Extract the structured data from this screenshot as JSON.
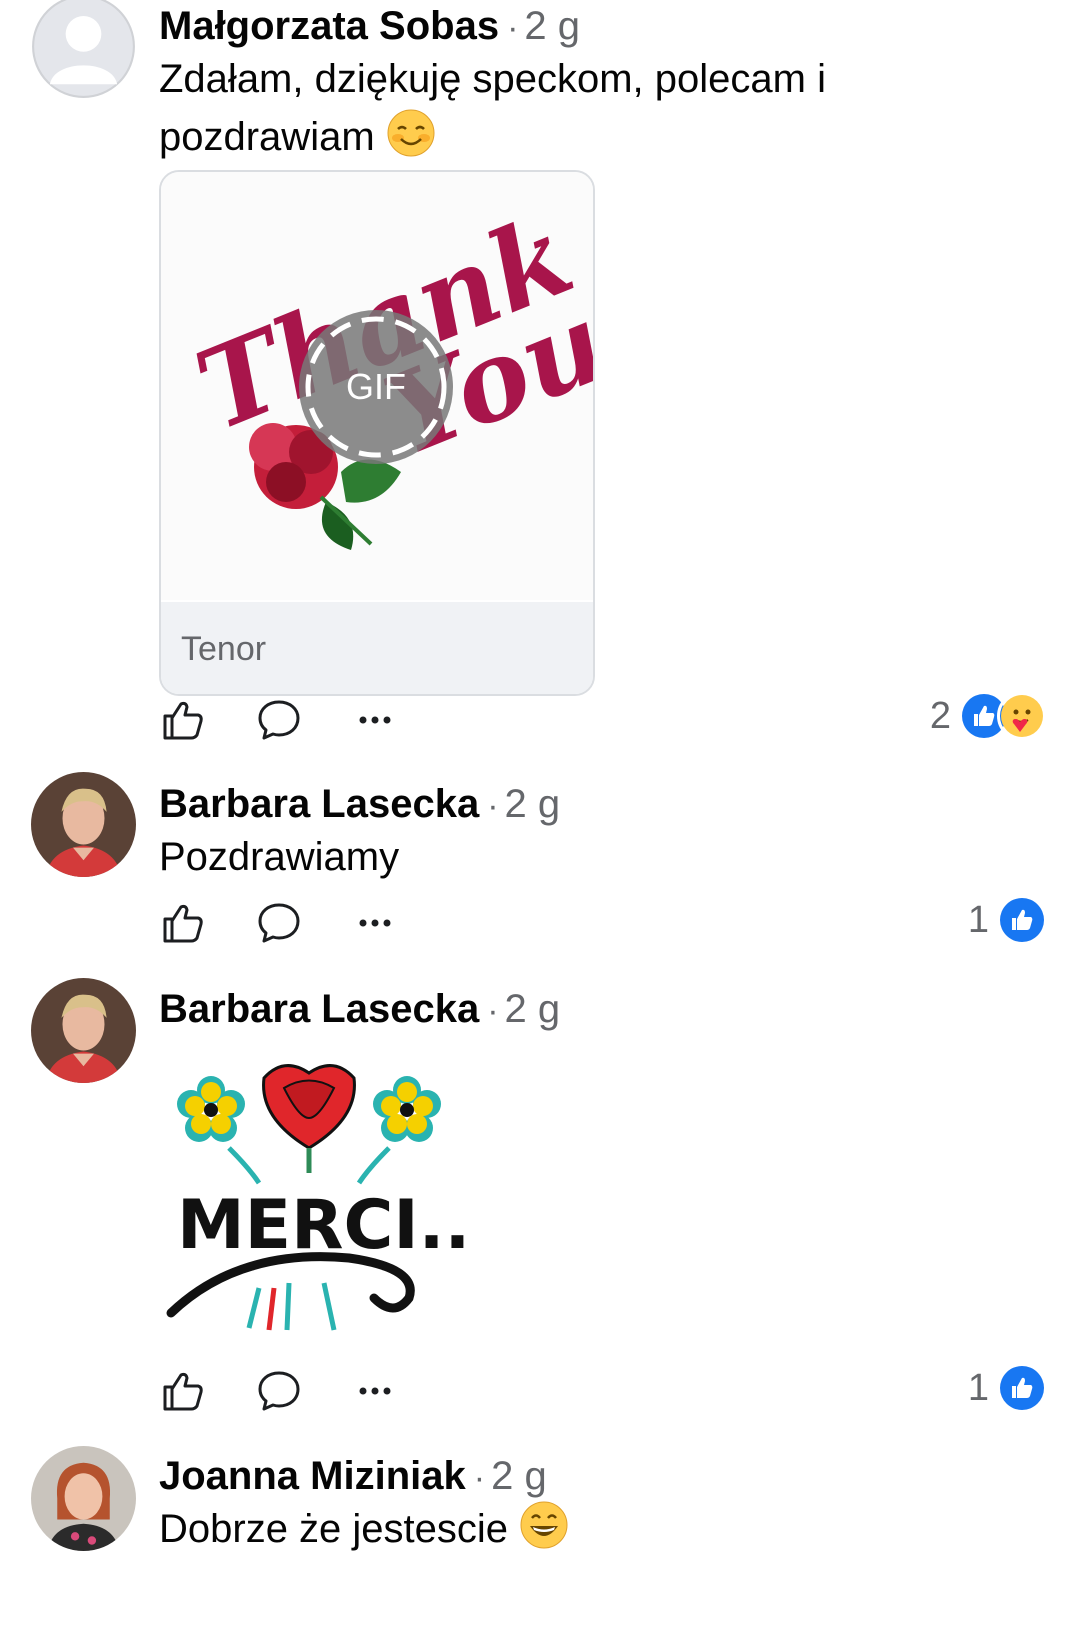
{
  "comments": [
    {
      "author": "Małgorzata Sobas",
      "time": "2 g",
      "text": "Zdałam, dziękuję speckom, polecam i pozdrawiam",
      "gif": {
        "badge": "GIF",
        "source": "Tenor",
        "image_text": "Thank You"
      },
      "reactions": {
        "count": "2",
        "types": [
          "like",
          "care"
        ]
      }
    },
    {
      "author": "Barbara Lasecka",
      "time": "2 g",
      "text": "Pozdrawiamy",
      "reactions": {
        "count": "1",
        "types": [
          "like"
        ]
      }
    },
    {
      "author": "Barbara Lasecka",
      "time": "2 g",
      "sticker": {
        "image_text": "MERCI..."
      },
      "reactions": {
        "count": "1",
        "types": [
          "like"
        ]
      }
    },
    {
      "author": "Joanna Miziniak",
      "time": "2 g",
      "text": "Dobrze że jestescie"
    }
  ],
  "icons": {
    "like": "thumbs-up-outline-icon",
    "reply": "speech-bubble-icon",
    "more": "more-dots-icon",
    "like_reaction": "like-reaction-icon",
    "care_reaction": "care-reaction-icon"
  },
  "colors": {
    "like_blue": "#1877f2",
    "meta_gray": "#65676b",
    "name": "#050505"
  }
}
